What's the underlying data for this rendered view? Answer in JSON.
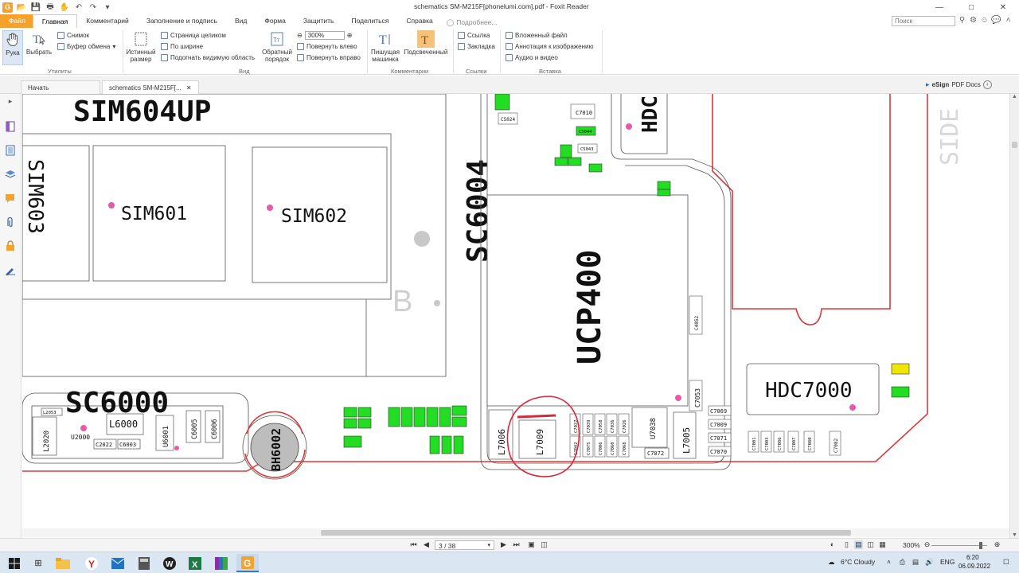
{
  "window": {
    "title": "schematics SM-M215F[phonelumi.com].pdf - Foxit Reader",
    "app_logo": "G"
  },
  "menu": {
    "file": "Файл",
    "tabs": [
      "Главная",
      "Комментарий",
      "Заполнение и подпись",
      "Вид",
      "Форма",
      "Защитить",
      "Поделиться",
      "Справка"
    ],
    "help_search": "Подробнее...",
    "find_placeholder": "Поиск"
  },
  "ribbon": {
    "hand": "Рука",
    "select": "Выбрать",
    "snapshot": "Снимок",
    "clipboard": "Буфер обмена",
    "group_utils": "Утилиты",
    "actual_size_l1": "Истинный",
    "actual_size_l2": "размер",
    "fit_page": "Страница целиком",
    "fit_width": "По ширине",
    "fit_visible": "Подогнать видимую область",
    "reverse_l1": "Обратный",
    "reverse_l2": "порядок",
    "zoom_value": "300%",
    "rotate_left": "Повернуть влево",
    "rotate_right": "Повернуть вправо",
    "group_view": "Вид",
    "typewriter_l1": "Пишущая",
    "typewriter_l2": "машинка",
    "highlight": "Подсвеченный",
    "group_comments": "Комментарии",
    "link": "Ссылка",
    "bookmark": "Закладка",
    "group_links": "Ссылки",
    "attached_file": "Вложенный файл",
    "image_annotation": "Аннотация к изображению",
    "audio_video": "Аудио и видео",
    "group_insert": "Вставка"
  },
  "doc_tabs": {
    "start": "Начать",
    "current": "schematics SM-M215F[...",
    "esign": "eSign",
    "pdf_docs": "PDF Docs"
  },
  "schematic": {
    "labels": {
      "sim604up": "SIM604UP",
      "sim603": "SIM603",
      "sim601": "SIM601",
      "sim602": "SIM602",
      "sc6004": "SC6004",
      "ucp400": "UCP400",
      "hdc_top": "HDC",
      "side": "SIDE",
      "b": "B",
      "sc6000": "SC6000",
      "bh6002": "BH6002",
      "hdc7000": "HDC7000",
      "l2020": "L2020",
      "u2000": "U2000",
      "l6000": "L6000",
      "u6001": "U6001",
      "c6005": "C6005",
      "c6006": "C6006",
      "l2053": "L2053",
      "c2022": "C2022",
      "c6003": "C6003",
      "l7006": "L7006",
      "l7005": "L7005",
      "l7009": "L7009",
      "u7038": "U7038",
      "c7072": "C7072",
      "c7053": "C7053",
      "c7010": "C7010",
      "c5043": "C5043",
      "c5024": "C5024",
      "c5044": "C5044",
      "c4052": "C4052",
      "c7069": "C7069",
      "c7009": "C7009",
      "c7071": "C7071",
      "c7070": "C7070",
      "c7082": "C7082"
    },
    "small_vertical": [
      "C7037",
      "C7039",
      "C7058",
      "C7036",
      "C7026",
      "C7042",
      "C7075",
      "C7006",
      "C7060",
      "C7068",
      "C7001",
      "C7003",
      "C7086",
      "C7007",
      "C7080"
    ]
  },
  "status": {
    "page": "3 / 38",
    "zoom": "300%"
  },
  "taskbar": {
    "weather": "6°C  Cloudy",
    "lang": "ENG",
    "time": "6:20",
    "date": "06.09.2022"
  },
  "colors": {
    "accent": "#f5a12d",
    "board_outline": "#d93a3a",
    "pad_green": "#22dd22"
  }
}
